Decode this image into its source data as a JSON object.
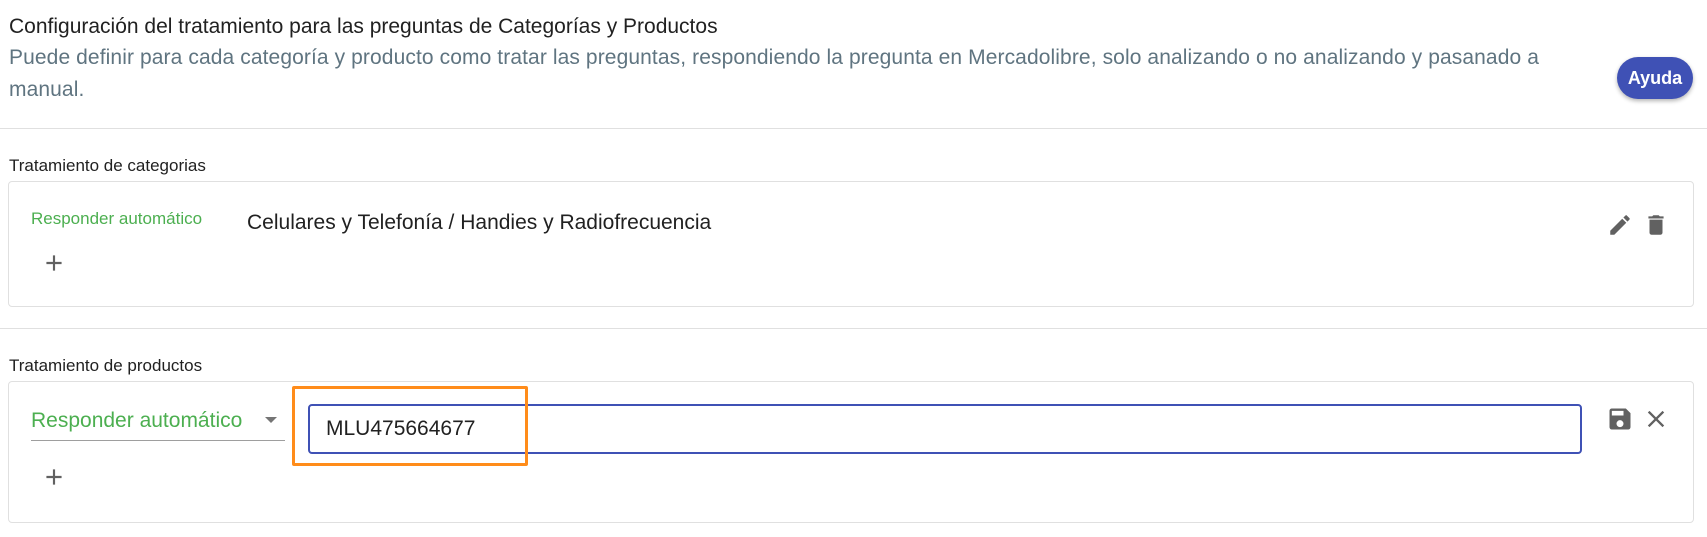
{
  "header": {
    "title": "Configuración del tratamiento para las preguntas de Categorías y Productos",
    "subtitle": "Puede definir para cada categoría y producto como tratar las preguntas, respondiendo la pregunta en Mercadolibre, solo analizando o no analizando y pasanado a manual.",
    "help_label": "Ayuda"
  },
  "categories": {
    "section_label": "Tratamiento de categorias",
    "rule": {
      "treatment": "Responder automático",
      "value": "Celulares y Telefonía / Handies y Radiofrecuencia"
    },
    "icons": [
      "edit-icon",
      "delete-icon",
      "add-icon"
    ]
  },
  "products": {
    "section_label": "Tratamiento de productos",
    "select_value": "Responder automático",
    "input_value": "MLU475664677",
    "icons": [
      "save-icon",
      "close-icon",
      "add-icon"
    ]
  },
  "colors": {
    "accent": "#3f51b5",
    "green": "#4caf50",
    "highlight": "#ff8c1a"
  }
}
